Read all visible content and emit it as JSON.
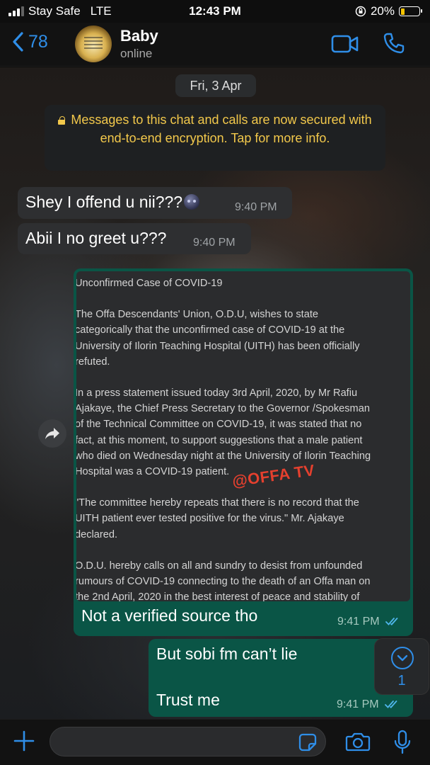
{
  "status_bar": {
    "carrier": "Stay Safe",
    "network": "LTE",
    "time": "12:43 PM",
    "battery_percent": "20%",
    "battery_level": 0.2,
    "battery_color": "#f5c400"
  },
  "header": {
    "back_count": "78",
    "contact_name": "Baby",
    "contact_status": "online",
    "accent_color": "#2f8ee8",
    "icons": [
      "chevron-left-icon",
      "video-call-icon",
      "phone-icon"
    ]
  },
  "chat": {
    "date_chip": "Fri, 3 Apr",
    "encryption_notice": "Messages to this chat and calls are now secured with end-to-end encryption. Tap for more info.",
    "messages": [
      {
        "direction": "incoming",
        "text": "Shey I offend u nii???",
        "emoji": "new-moon-face",
        "time": "9:40 PM"
      },
      {
        "direction": "incoming",
        "text": "Abii I no greet u???",
        "time": "9:40 PM"
      },
      {
        "direction": "outgoing",
        "type": "image",
        "image_text": {
          "title": "Unconfirmed Case of COVID-19",
          "paragraphs": [
            [
              "The Offa Descendants' Union, O.D.U, wishes to state",
              "categorically that the unconfirmed case of COVID-19 at the",
              "University of Ilorin Teaching Hospital (UITH) has been officially",
              "refuted."
            ],
            [
              "In a press statement issued today 3rd April, 2020, by Mr Rafiu",
              "Ajakaye, the Chief Press Secretary to the Governor /Spokesman",
              "of the Technical Committee on COVID-19, it was stated that no",
              "fact, at this moment, to support suggestions that a male patient",
              "who died on Wednesday night at the University of Ilorin Teaching",
              "Hospital was a COVID-19 patient."
            ],
            [
              "\"The committee hereby repeats that there is no record that the",
              "UITH patient ever tested positive for the virus.\" Mr. Ajakaye",
              "declared."
            ],
            [
              "O.D.U. hereby calls on all and sundry to desist from unfounded",
              "rumours of COVID-19 connecting to the death of an Offa man on",
              "the 2nd April, 2020 in the best interest of peace and stability of"
            ]
          ],
          "watermark": "@OFFA TV"
        },
        "caption": "Not a verified source tho",
        "time": "9:41 PM",
        "read": true
      },
      {
        "direction": "outgoing",
        "lines": [
          "But sobi fm can’t lie",
          "Trust me"
        ],
        "time": "9:41 PM",
        "read": true
      }
    ],
    "unread_count": "1"
  },
  "input_bar": {
    "message_value": "",
    "icons": [
      "plus-icon",
      "sticker-icon",
      "camera-icon",
      "microphone-icon"
    ]
  },
  "colors": {
    "outgoing_bubble": "#0a5546",
    "incoming_bubble": "#2e2f31",
    "encryption_text": "#f2c84b",
    "read_ticks": "#4fb6ec"
  }
}
